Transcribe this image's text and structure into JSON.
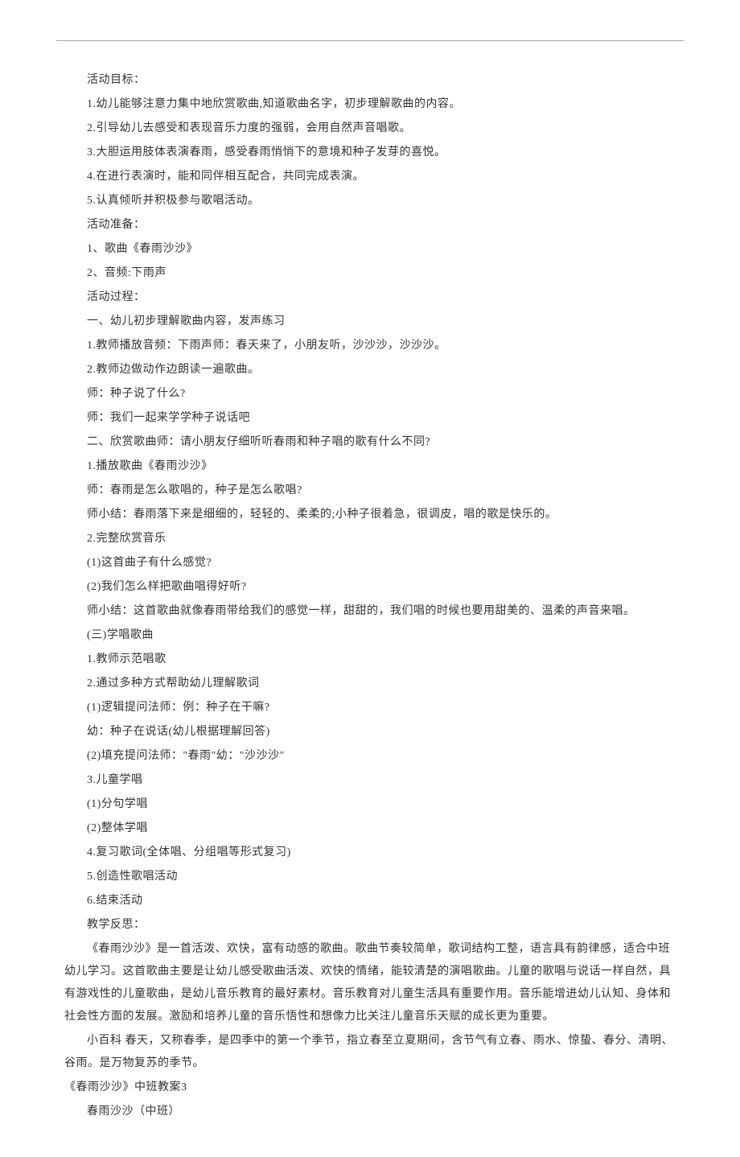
{
  "divider": true,
  "lines": [
    {
      "text": "活动目标：",
      "indent": true
    },
    {
      "text": "1.幼儿能够注意力集中地欣赏歌曲,知道歌曲名字，初步理解歌曲的内容。",
      "indent": true
    },
    {
      "text": "2.引导幼儿去感受和表现音乐力度的强弱，会用自然声音唱歌。",
      "indent": true
    },
    {
      "text": "3.大胆运用肢体表演春雨，感受春雨悄悄下的意境和种子发芽的喜悦。",
      "indent": true
    },
    {
      "text": "4.在进行表演时，能和同伴相互配合，共同完成表演。",
      "indent": true
    },
    {
      "text": "5.认真倾听并积极参与歌唱活动。",
      "indent": true
    },
    {
      "text": "活动准备：",
      "indent": true
    },
    {
      "text": "1、歌曲《春雨沙沙》",
      "indent": true
    },
    {
      "text": "2、音频:下雨声",
      "indent": true
    },
    {
      "text": "活动过程：",
      "indent": true
    },
    {
      "text": "一、幼儿初步理解歌曲内容，发声练习",
      "indent": true
    },
    {
      "text": "1.教师播放音频：下雨声师：春天来了，小朋友听，沙沙沙，沙沙沙。",
      "indent": true
    },
    {
      "text": "2.教师边做动作边朗读一遍歌曲。",
      "indent": true
    },
    {
      "text": "师：种子说了什么?",
      "indent": true
    },
    {
      "text": "师：我们一起来学学种子说话吧",
      "indent": true
    },
    {
      "text": "二、欣赏歌曲师：请小朋友仔细听听春雨和种子唱的歌有什么不同?",
      "indent": true
    },
    {
      "text": "1.播放歌曲《春雨沙沙》",
      "indent": true
    },
    {
      "text": "师：春雨是怎么歌唱的，种子是怎么歌唱?",
      "indent": true
    },
    {
      "text": "师小结：春雨落下来是细细的，轻轻的、柔柔的;小种子很着急，很调皮，唱的歌是快乐的。",
      "indent": true
    },
    {
      "text": "2.完整欣赏音乐",
      "indent": true
    },
    {
      "text": "(1)这首曲子有什么感觉?",
      "indent": true
    },
    {
      "text": "(2)我们怎么样把歌曲唱得好听?",
      "indent": true
    },
    {
      "text": "师小结：这首歌曲就像春雨带给我们的感觉一样，甜甜的，我们唱的时候也要用甜美的、温柔的声音来唱。",
      "indent": true
    },
    {
      "text": "(三)学唱歌曲",
      "indent": true
    },
    {
      "text": "1.教师示范唱歌",
      "indent": true
    },
    {
      "text": "2.通过多种方式帮助幼儿理解歌词",
      "indent": true
    },
    {
      "text": "(1)逻辑提问法师：例：种子在干嘛?",
      "indent": true
    },
    {
      "text": "幼：种子在说话(幼儿根据理解回答)",
      "indent": true
    },
    {
      "text": "(2)填充提问法师：\"春雨\"幼：\"沙沙沙\"",
      "indent": true
    },
    {
      "text": "3.儿童学唱",
      "indent": true
    },
    {
      "text": "(1)分句学唱",
      "indent": true
    },
    {
      "text": "(2)整体学唱",
      "indent": true
    },
    {
      "text": "4.复习歌词(全体唱、分组唱等形式复习)",
      "indent": true
    },
    {
      "text": "5.创造性歌唱活动",
      "indent": true
    },
    {
      "text": "6.结束活动",
      "indent": true
    },
    {
      "text": "教学反思：",
      "indent": true
    },
    {
      "text": "《春雨沙沙》是一首活泼、欢快，富有动感的歌曲。歌曲节奏较简单，歌词结构工整，语言具有韵律感，适合中班幼儿学习。这首歌曲主要是让幼儿感受歌曲活泼、欢快的情绪，能较清楚的演唱歌曲。儿童的歌唱与说话一样自然，具有游戏性的儿童歌曲，是幼儿音乐教育的最好素材。音乐教育对儿童生活具有重要作用。音乐能增进幼儿认知、身体和社会性方面的发展。激励和培养儿童的音乐悟性和想像力比关注儿童音乐天赋的成长更为重要。",
      "indent": true
    },
    {
      "text": "小百科 春天，又称春季，是四季中的第一个季节，指立春至立夏期间，含节气有立春、雨水、惊蛰、春分、清明、谷雨。是万物复苏的季节。",
      "indent": true
    },
    {
      "text": "《春雨沙沙》中班教案3",
      "indent": false
    },
    {
      "text": "春雨沙沙（中班）",
      "indent": true
    }
  ]
}
